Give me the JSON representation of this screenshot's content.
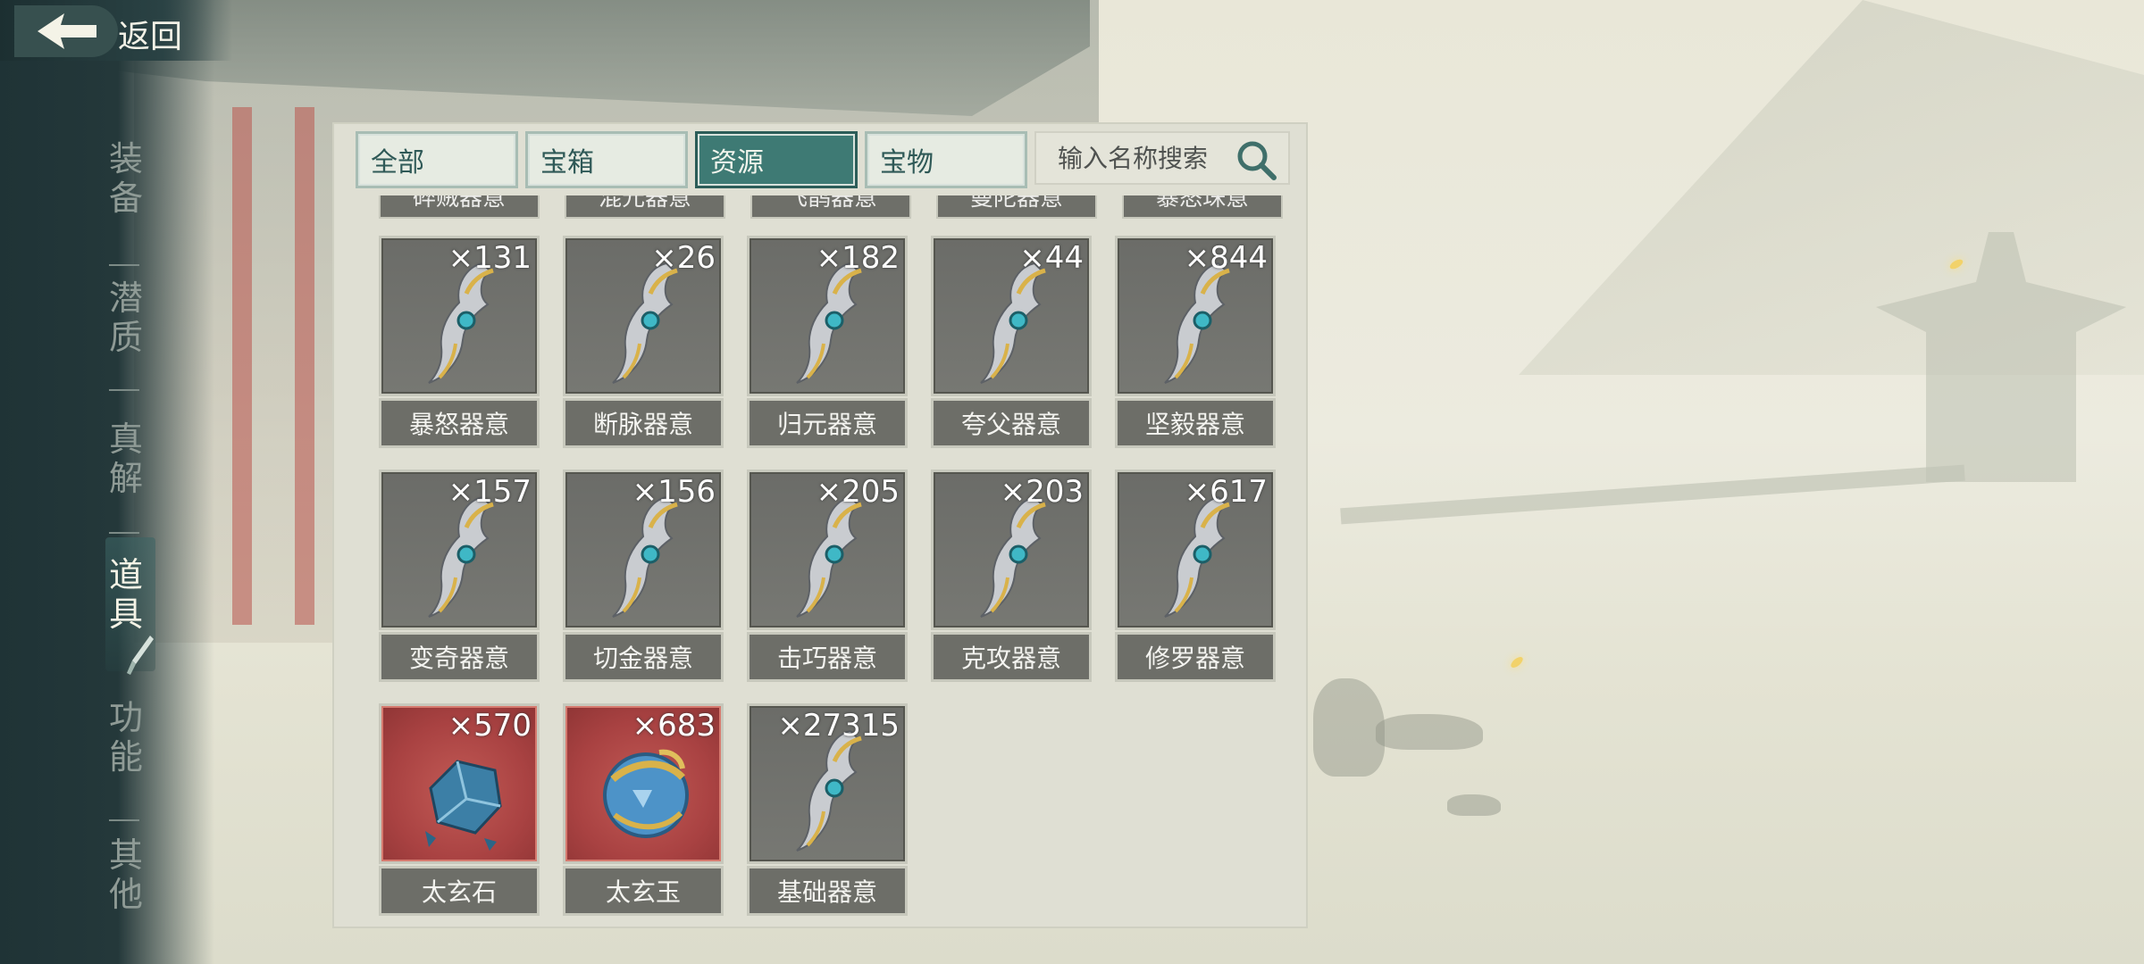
{
  "header": {
    "back_label": "返回"
  },
  "side_nav": {
    "items": [
      {
        "label": "装备",
        "active": false
      },
      {
        "label": "潜质",
        "active": false
      },
      {
        "label": "真解",
        "active": false
      },
      {
        "label": "道具",
        "active": true
      },
      {
        "label": "功能",
        "active": false
      },
      {
        "label": "其他",
        "active": false
      }
    ]
  },
  "tabs": [
    {
      "label": "全部",
      "active": false
    },
    {
      "label": "宝箱",
      "active": false
    },
    {
      "label": "资源",
      "active": true
    },
    {
      "label": "宝物",
      "active": false
    }
  ],
  "search": {
    "placeholder": "输入名称搜索"
  },
  "partial_row_labels": [
    "碎贼器意",
    "混元器意",
    "飞鹊器意",
    "曼陀器意",
    "暴怒珠意"
  ],
  "items": [
    {
      "name": "暴怒器意",
      "count": "×131",
      "icon": "artifact-blade-icon",
      "rarity": "normal"
    },
    {
      "name": "断脉器意",
      "count": "×26",
      "icon": "artifact-blade-icon",
      "rarity": "normal"
    },
    {
      "name": "归元器意",
      "count": "×182",
      "icon": "artifact-blade-icon",
      "rarity": "normal"
    },
    {
      "name": "夸父器意",
      "count": "×44",
      "icon": "artifact-blade-icon",
      "rarity": "normal"
    },
    {
      "name": "坚毅器意",
      "count": "×844",
      "icon": "artifact-blade-icon",
      "rarity": "normal"
    },
    {
      "name": "变奇器意",
      "count": "×157",
      "icon": "artifact-blade-icon",
      "rarity": "normal"
    },
    {
      "name": "切金器意",
      "count": "×156",
      "icon": "artifact-blade-icon",
      "rarity": "normal"
    },
    {
      "name": "击巧器意",
      "count": "×205",
      "icon": "artifact-blade-icon",
      "rarity": "normal"
    },
    {
      "name": "克攻器意",
      "count": "×203",
      "icon": "artifact-blade-icon",
      "rarity": "normal"
    },
    {
      "name": "修罗器意",
      "count": "×617",
      "icon": "artifact-blade-icon",
      "rarity": "normal"
    },
    {
      "name": "太玄石",
      "count": "×570",
      "icon": "blue-crystal-icon",
      "rarity": "red"
    },
    {
      "name": "太玄玉",
      "count": "×683",
      "icon": "jade-orb-icon",
      "rarity": "red"
    },
    {
      "name": "基础器意",
      "count": "×27315",
      "icon": "artifact-blade-icon",
      "rarity": "normal"
    }
  ],
  "colors": {
    "nav_bg": "#24383a",
    "tab_active": "#3e7a74",
    "tab_inactive": "#e6ebe2",
    "tile_bg": "#6b6c68",
    "tile_red": "#a94242",
    "panel_bg": "#dfdfd3"
  }
}
